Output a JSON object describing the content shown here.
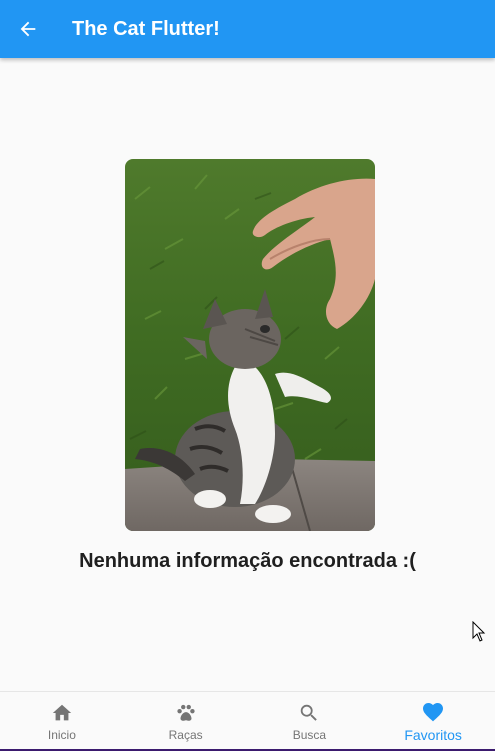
{
  "appbar": {
    "title": "The Cat Flutter!",
    "back_icon": "arrow-back-icon",
    "color": "#2196f3"
  },
  "main": {
    "image_alt": "kitten photo",
    "message": "Nenhuma informação encontrada :("
  },
  "bottom_nav": {
    "items": [
      {
        "label": "Inicio",
        "icon": "home-icon",
        "active": false
      },
      {
        "label": "Raças",
        "icon": "paw-icon",
        "active": false
      },
      {
        "label": "Busca",
        "icon": "search-icon",
        "active": false
      },
      {
        "label": "Favoritos",
        "icon": "heart-icon",
        "active": true
      }
    ],
    "active_color": "#2196f3",
    "inactive_color": "#757575"
  }
}
